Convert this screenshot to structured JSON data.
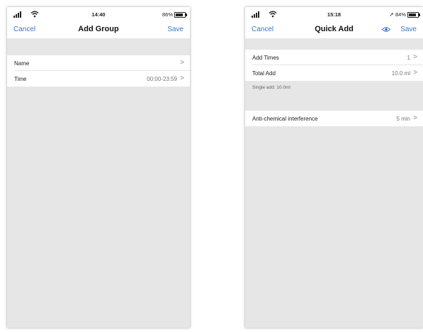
{
  "left_screen": {
    "status": {
      "time": "14:40",
      "battery_text": "86%",
      "battery_level": 0.86
    },
    "nav": {
      "cancel": "Cancel",
      "title": "Add Group",
      "save": "Save"
    },
    "rows": [
      {
        "label": "Name",
        "value": "",
        "chevron": ">"
      },
      {
        "label": "Time",
        "value": "00:00-23:59",
        "chevron": ">"
      }
    ]
  },
  "right_screen": {
    "status": {
      "time": "15:18",
      "battery_text": "84%",
      "battery_level": 0.84,
      "location_icon": "location-arrow-icon"
    },
    "nav": {
      "cancel": "Cancel",
      "title": "Quick Add",
      "save": "Save",
      "eye_icon": "eye-icon"
    },
    "rows": [
      {
        "label": "Add Times",
        "value": "1",
        "chevron": ">"
      },
      {
        "label": "Total Add",
        "value": "10.0 ml",
        "chevron": ">"
      }
    ],
    "note": "Single add: 10.0ml",
    "rows2": [
      {
        "label": "Anti-chemical interference",
        "value": "5 min",
        "chevron": ">"
      }
    ]
  },
  "colors": {
    "accent": "#3a78c4",
    "background": "#e6e6e6",
    "cell": "#ffffff"
  }
}
